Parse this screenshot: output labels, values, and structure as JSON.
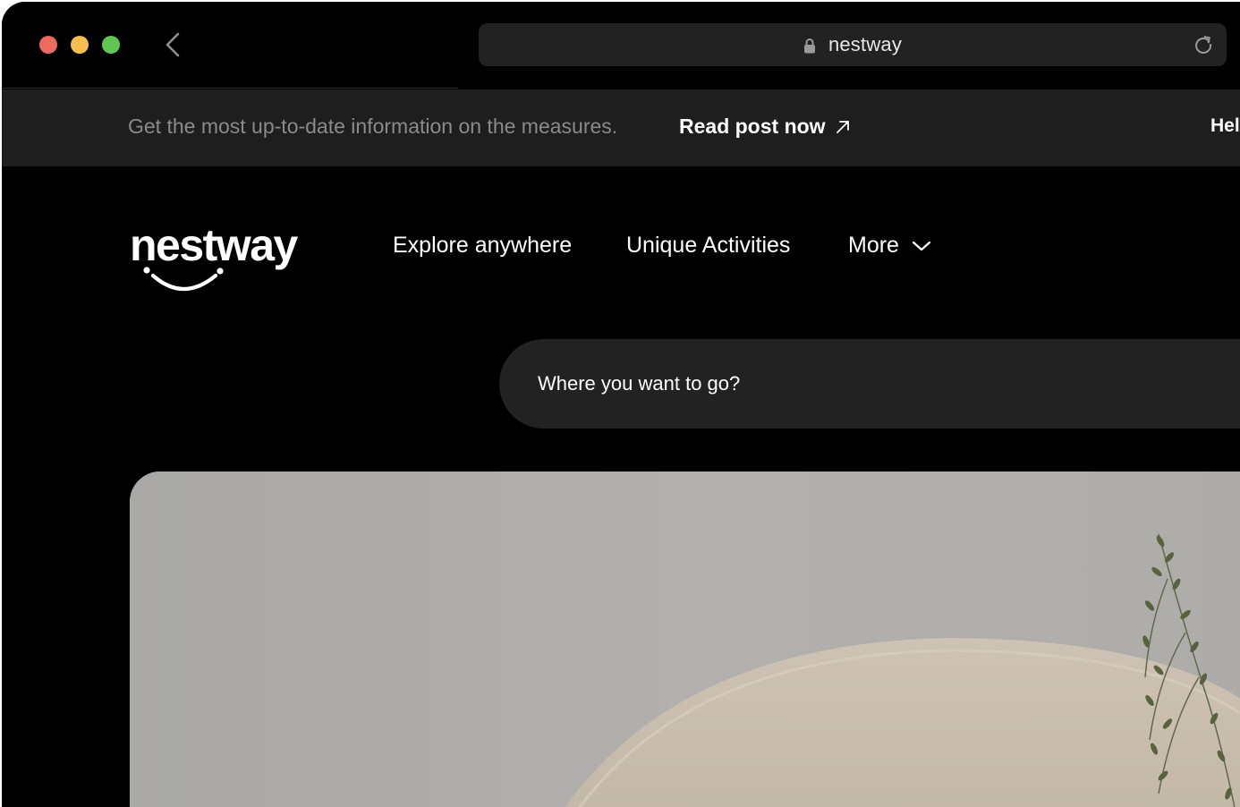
{
  "browser": {
    "url": "nestway",
    "icons": {
      "back": "chevron-left-icon",
      "lock": "lock-icon",
      "reload": "reload-icon"
    },
    "traffic_light_colors": {
      "close": "#ed6a5e",
      "minimize": "#f5bf4f",
      "maximize": "#61c554"
    }
  },
  "announcement": {
    "text": "Get the most up-to-date information on the measures.",
    "link_label": "Read post now",
    "link_icon": "arrow-up-right-icon",
    "help_label": "Hel"
  },
  "site": {
    "logo_text": "nestway",
    "nav": {
      "explore": "Explore anywhere",
      "activities": "Unique Activities",
      "more": "More",
      "more_icon": "chevron-down-icon"
    },
    "search": {
      "placeholder": "Where you want to go?"
    }
  },
  "colors": {
    "page_background": "#000000",
    "announcement_background": "#1e1e1e",
    "search_background": "#222222",
    "muted_text": "#8a8a8a",
    "text": "#ffffff"
  }
}
